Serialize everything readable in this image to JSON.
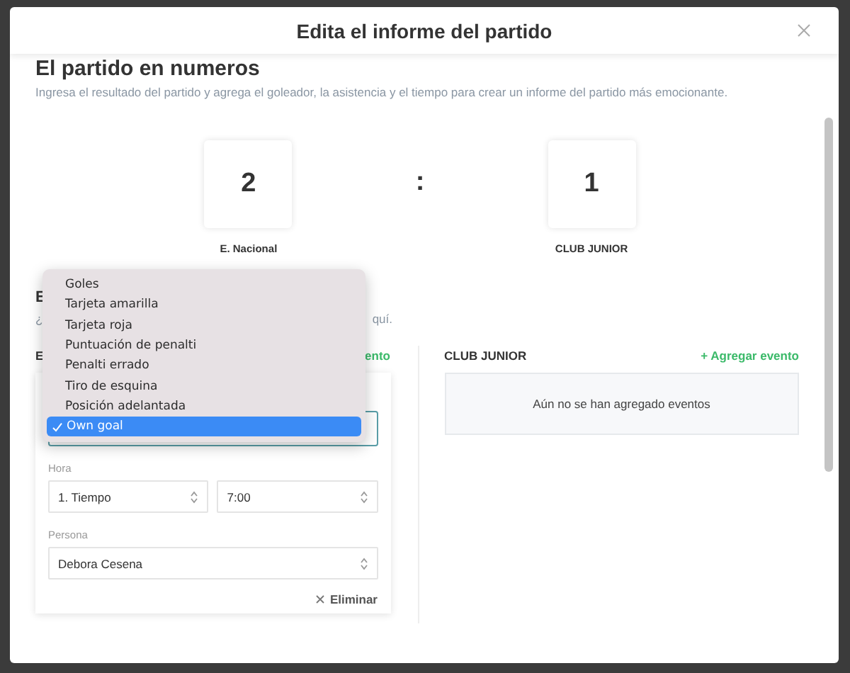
{
  "dialog": {
    "title": "Edita el informe del partido"
  },
  "section": {
    "title": "El partido en numeros",
    "description": "Ingresa el resultado del partido y agrega el goleador, la asistencia y el tiempo para crear un informe del partido más emocionante."
  },
  "score": {
    "separator": ":",
    "teams": [
      {
        "goals": "2",
        "name": "E. Nacional"
      },
      {
        "goals": "1",
        "name": "CLUB JUNIOR"
      }
    ]
  },
  "events_section": {
    "title": "E",
    "description_start": "¿",
    "description_end": "quí."
  },
  "teams": [
    {
      "name": "E",
      "add_label": "ento",
      "events": [
        {
          "time_label": "Hora",
          "period": "1. Tiempo",
          "minute": "7:00",
          "person_label": "Persona",
          "person": "Debora Cesena",
          "delete_label": "Eliminar"
        }
      ]
    },
    {
      "name": "CLUB JUNIOR",
      "add_label": "+ Agregar evento",
      "empty_text": "Aún no se han agregado eventos"
    }
  ],
  "dropdown": {
    "options": [
      {
        "label": "Goles",
        "selected": false
      },
      {
        "label": "Tarjeta amarilla",
        "selected": false
      },
      {
        "label": "Tarjeta roja",
        "selected": false
      },
      {
        "label": "Puntuación de penalti",
        "selected": false
      },
      {
        "label": "Penalti errado",
        "selected": false
      },
      {
        "label": "Tiro de esquina",
        "selected": false
      },
      {
        "label": "Posición adelantada",
        "selected": false
      },
      {
        "label": "Own goal",
        "selected": true
      }
    ]
  }
}
